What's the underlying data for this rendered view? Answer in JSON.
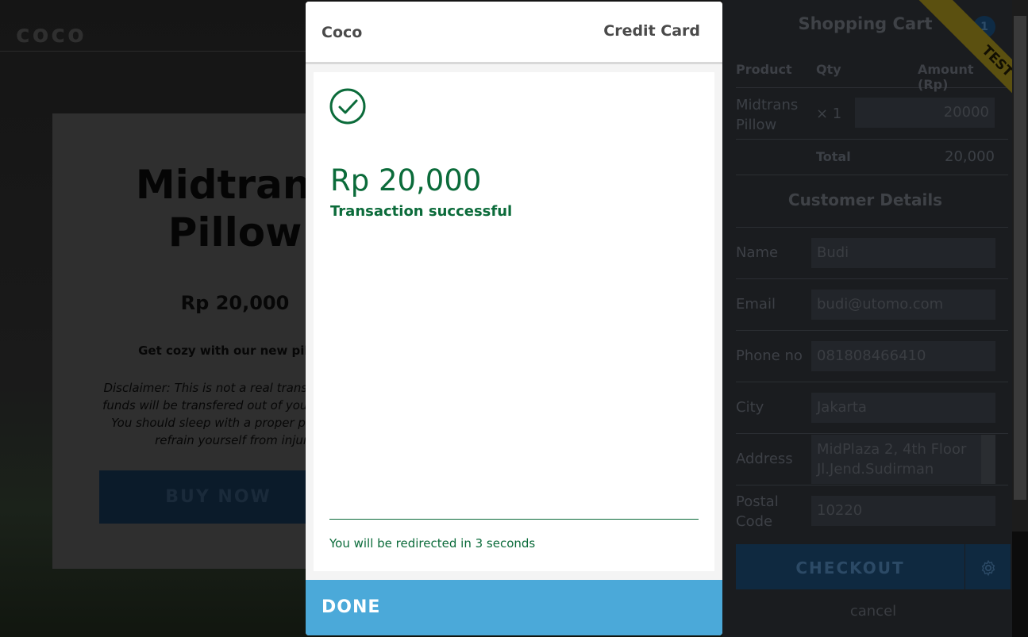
{
  "background": {
    "logo": "coco",
    "product": {
      "title_line1": "Midtrans",
      "title_line2": "Pillow",
      "price": "Rp 20,000",
      "description": "Get cozy with our new pillow",
      "disclaimer": "Disclaimer: This is not a real transaction, no funds will be transfered out of your account. You should sleep with a proper pillow and refrain yourself from injury",
      "buy_button": "BUY NOW"
    }
  },
  "cart": {
    "title": "Shopping Cart",
    "badge_count": "1",
    "columns": [
      "Product",
      "Qty",
      "Amount (Rp)"
    ],
    "item": {
      "product_line1": "Midtrans",
      "product_line2": "Pillow",
      "qty": "× 1",
      "amount": "20000"
    },
    "total_label": "Total",
    "total_value": "20,000",
    "customer_title": "Customer Details",
    "fields": [
      {
        "label": "Name",
        "value": "Budi"
      },
      {
        "label": "Email",
        "value": "budi@utomo.com"
      },
      {
        "label": "Phone no",
        "value": "081808466410"
      },
      {
        "label": "City",
        "value": "Jakarta"
      },
      {
        "label": "Address",
        "value_line1": "MidPlaza 2, 4th Floor",
        "value_line2": "Jl.Jend.Sudirman"
      },
      {
        "label_line1": "Postal",
        "label_line2": "Code",
        "value": "10220"
      }
    ],
    "checkout_button": "CHECKOUT",
    "cancel_link": "cancel",
    "ribbon": "TEST"
  },
  "modal": {
    "merchant": "Coco",
    "payment_method": "Credit Card",
    "amount": "Rp 20,000",
    "status": "Transaction successful",
    "redirect_text": "You will be redirected in 3 seconds",
    "done_button": "DONE",
    "colors": {
      "success": "#0b6b3a",
      "done": "#4ba9d9"
    }
  }
}
